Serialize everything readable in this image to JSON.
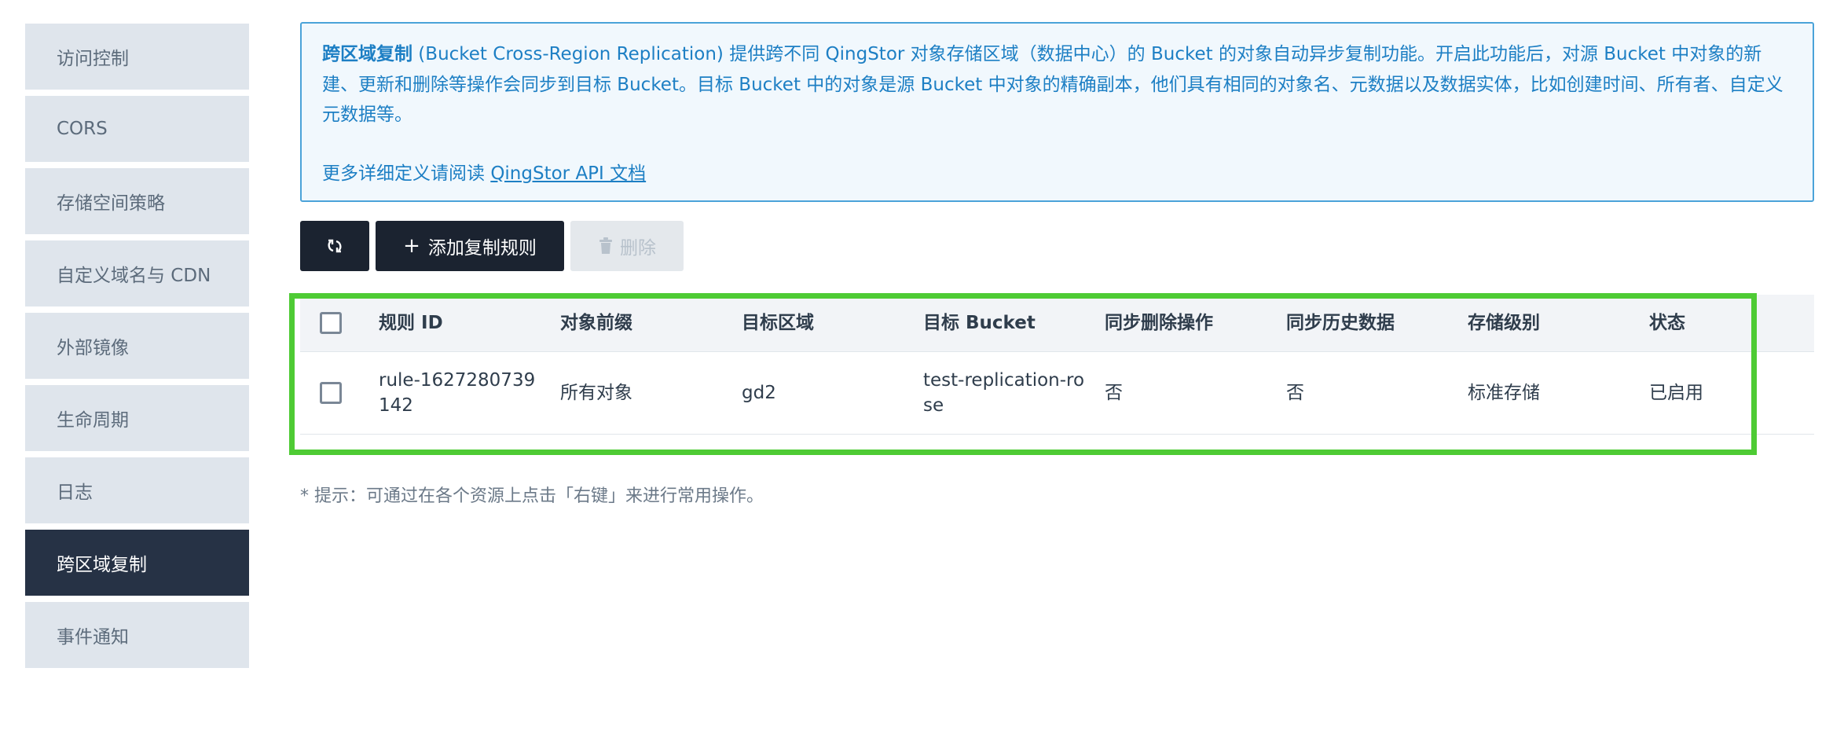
{
  "sidebar": {
    "items": [
      {
        "label": "访问控制"
      },
      {
        "label": "CORS"
      },
      {
        "label": "存储空间策略"
      },
      {
        "label": "自定义域名与 CDN"
      },
      {
        "label": "外部镜像"
      },
      {
        "label": "生命周期"
      },
      {
        "label": "日志"
      },
      {
        "label": "跨区域复制",
        "active": true
      },
      {
        "label": "事件通知"
      }
    ]
  },
  "info": {
    "lead": "跨区域复制",
    "text": " (Bucket Cross-Region Replication) 提供跨不同 QingStor 对象存储区域（数据中心）的 Bucket 的对象自动异步复制功能。开启此功能后，对源 Bucket 中对象的新建、更新和删除等操作会同步到目标 Bucket。目标 Bucket 中的对象是源 Bucket 中对象的精确副本，他们具有相同的对象名、元数据以及数据实体，比如创建时间、所有者、自定义元数据等。",
    "more_prefix": "更多详细定义请阅读 ",
    "more_link": "QingStor API 文档"
  },
  "toolbar": {
    "refresh_icon": "refresh-icon",
    "add_label": "添加复制规则",
    "add_icon": "+",
    "delete_label": "删除",
    "delete_icon": "trash-icon"
  },
  "table": {
    "columns": [
      "规则 ID",
      "对象前缀",
      "目标区域",
      "目标 Bucket",
      "同步删除操作",
      "同步历史数据",
      "存储级别",
      "状态"
    ],
    "rows": [
      {
        "id": "rule-1627280739142",
        "prefix": "所有对象",
        "region": "gd2",
        "bucket": "test-replication-rose",
        "sync_delete": "否",
        "sync_history": "否",
        "storage_class": "标准存储",
        "status": "已启用"
      }
    ]
  },
  "tip": "* 提示：可通过在各个资源上点击「右键」来进行常用操作。",
  "colors": {
    "highlight": "#4ecb34",
    "info_text": "#1d7fc4",
    "sidebar_active": "#263245"
  }
}
